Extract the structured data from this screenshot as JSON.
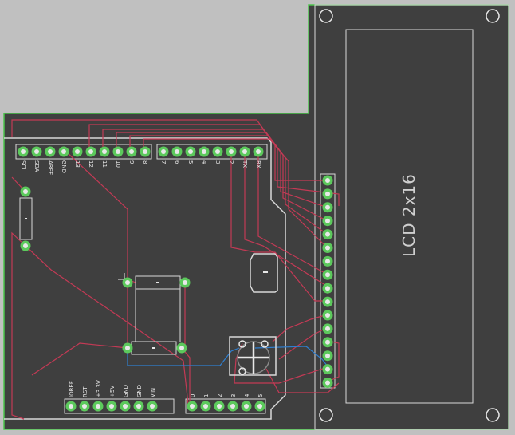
{
  "board": {
    "lcd_label": "LCD 2x16",
    "colors": {
      "background": "#c0c0c0",
      "pcb": "#3f3f3f",
      "outline": "#4cc44c",
      "silk": "#d8d8d8",
      "trace_top": "#c33a55",
      "trace_bottom": "#2f7fd0",
      "pad_ring": "#5cc95c",
      "pad_hole": "#e8e8e8"
    },
    "header_top_left_labels": [
      "SCL",
      "SDA",
      "AREF",
      "GND",
      "13",
      "12",
      "11",
      "10",
      "9",
      "8"
    ],
    "header_top_right_labels": [
      "7",
      "6",
      "5",
      "4",
      "3",
      "2",
      "TX",
      "RX"
    ],
    "header_bottom_left_labels": [
      "IOREF",
      "RST",
      "+3.3V",
      "+5V",
      "GND",
      "GND",
      "VIN"
    ],
    "header_bottom_right_labels": [
      "0",
      "1",
      "2",
      "3",
      "4",
      "5"
    ],
    "lcd_pin_count": 16
  }
}
